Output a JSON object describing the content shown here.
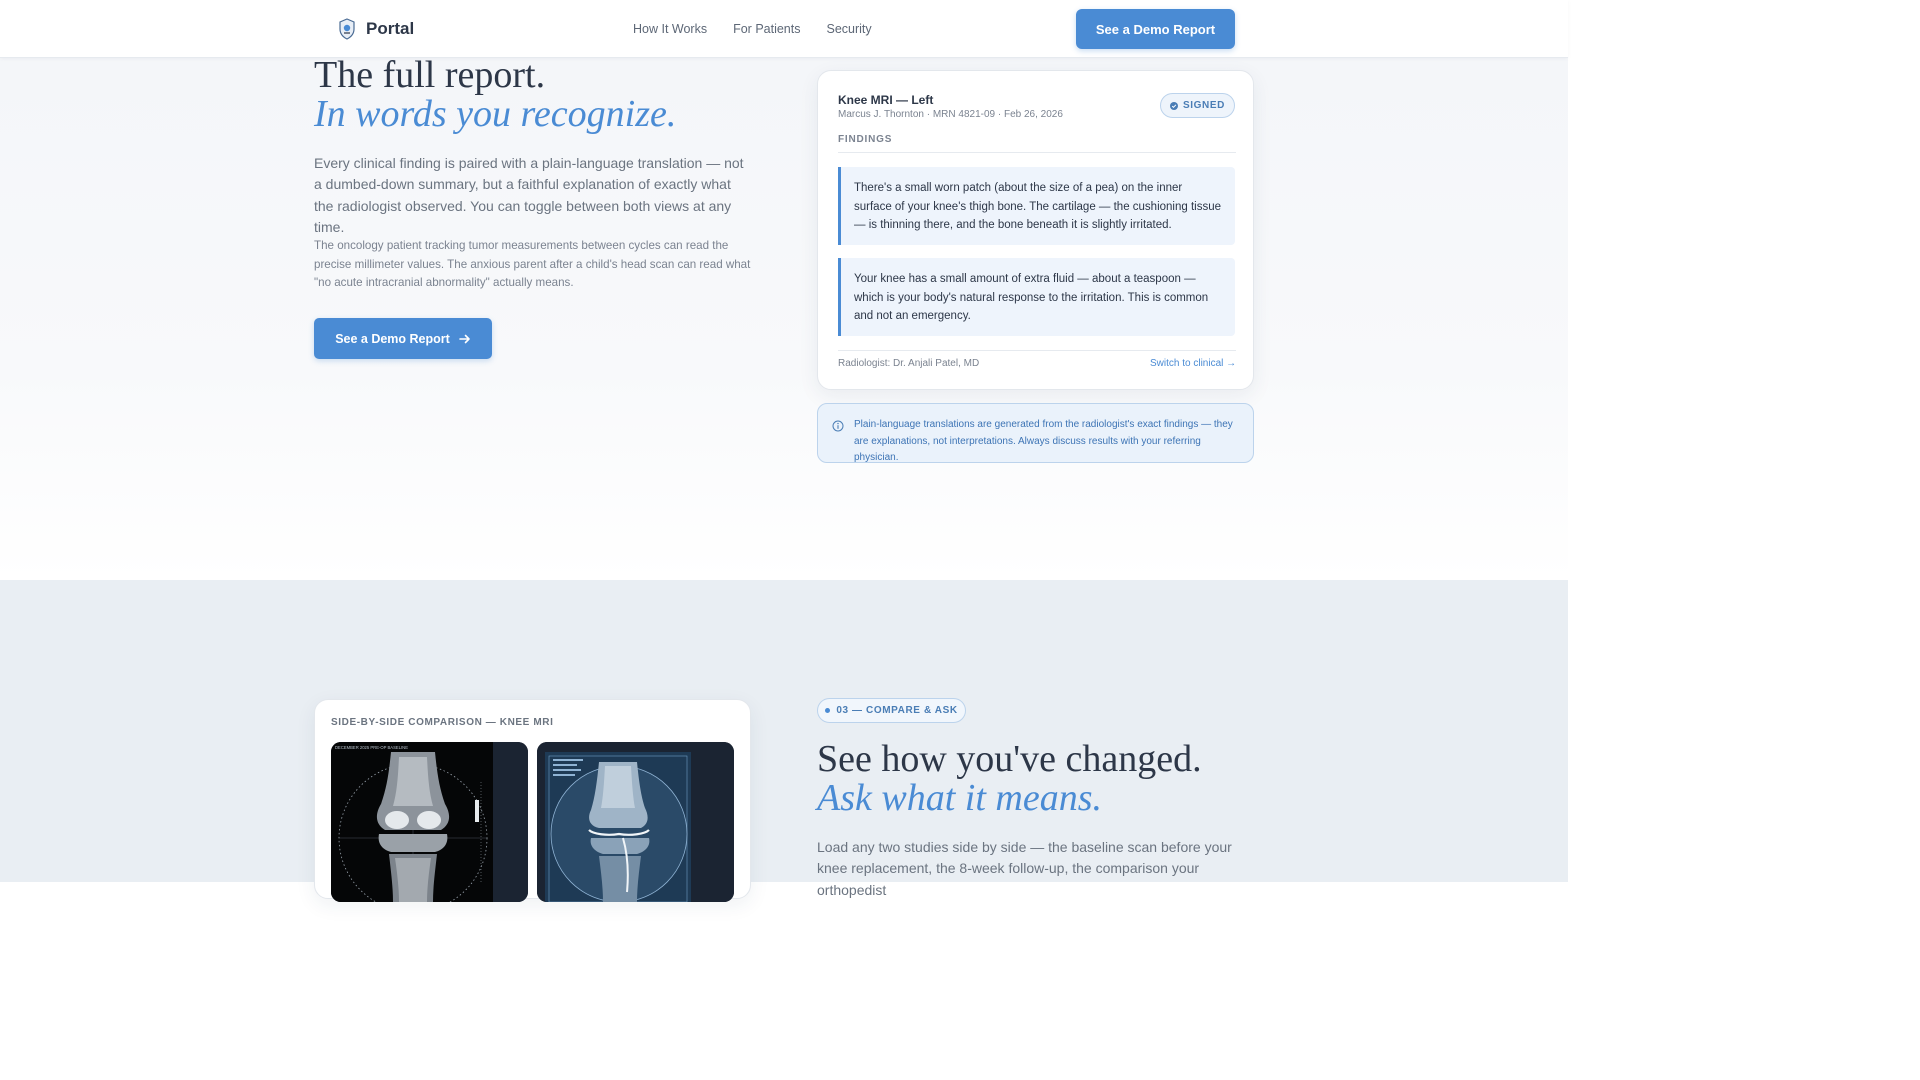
{
  "nav": {
    "logo_text": "Portal",
    "links": [
      "How It Works",
      "For Patients",
      "Security"
    ],
    "cta_label": "See a Demo Report"
  },
  "hero": {
    "title_line1": "The full report.",
    "title_line2": "In words you recognize.",
    "lead": "Every clinical finding is paired with a plain-language translation — not a dumbed-down summary, but a faithful explanation of exactly what the radiologist observed. You can toggle between both views at any time.",
    "sub": "The oncology patient tracking tumor measurements between cycles can read the precise millimeter values. The anxious parent after a child's head scan can read what \"no acute intracranial abnormality\" actually means.",
    "cta_label": "See a Demo Report",
    "cta_icon": "arrow-right-icon"
  },
  "report": {
    "title": "Knee MRI — Left",
    "meta": "Marcus J. Thornton · MRN 4821-09 · Feb 26, 2026",
    "badge": "SIGNED",
    "section": "FINDINGS",
    "findings": [
      "There's a small worn patch (about the size of a pea) on the inner surface of your knee's thigh bone. The cartilage — the cushioning tissue — is thinning there, and the bone beneath it is slightly irritated.",
      "Your knee has a small amount of extra fluid — about a teaspoon — which is your body's natural response to the irritation. This is common and not an emergency."
    ],
    "radiologist": "Radiologist: Dr. Anjali Patel, MD",
    "switch_label": "Switch to clinical →"
  },
  "disclaimer": {
    "icon": "info-icon",
    "text": "Plain-language translations are generated from the radiologist's exact findings — they are explanations, not interpretations. Always discuss results with your referring physician."
  },
  "compare": {
    "label": "SIDE-BY-SIDE COMPARISON — KNEE MRI",
    "scan_a_caption": "DECEMBER 2025 PRE-OP BASELINE"
  },
  "section2": {
    "step": "03 — COMPARE & ASK",
    "title_line1": "See how you've changed.",
    "title_line2": "Ask what it means.",
    "lead": "Load any two studies side by side — the baseline scan before your knee replacement, the 8-week follow-up, the comparison your orthopedist"
  },
  "colors": {
    "accent": "#4a8bd4",
    "text_dark": "#2d3748",
    "text_muted": "#6b7480",
    "section_bg": "#e9eef3",
    "finding_bg": "#eef4fc"
  }
}
